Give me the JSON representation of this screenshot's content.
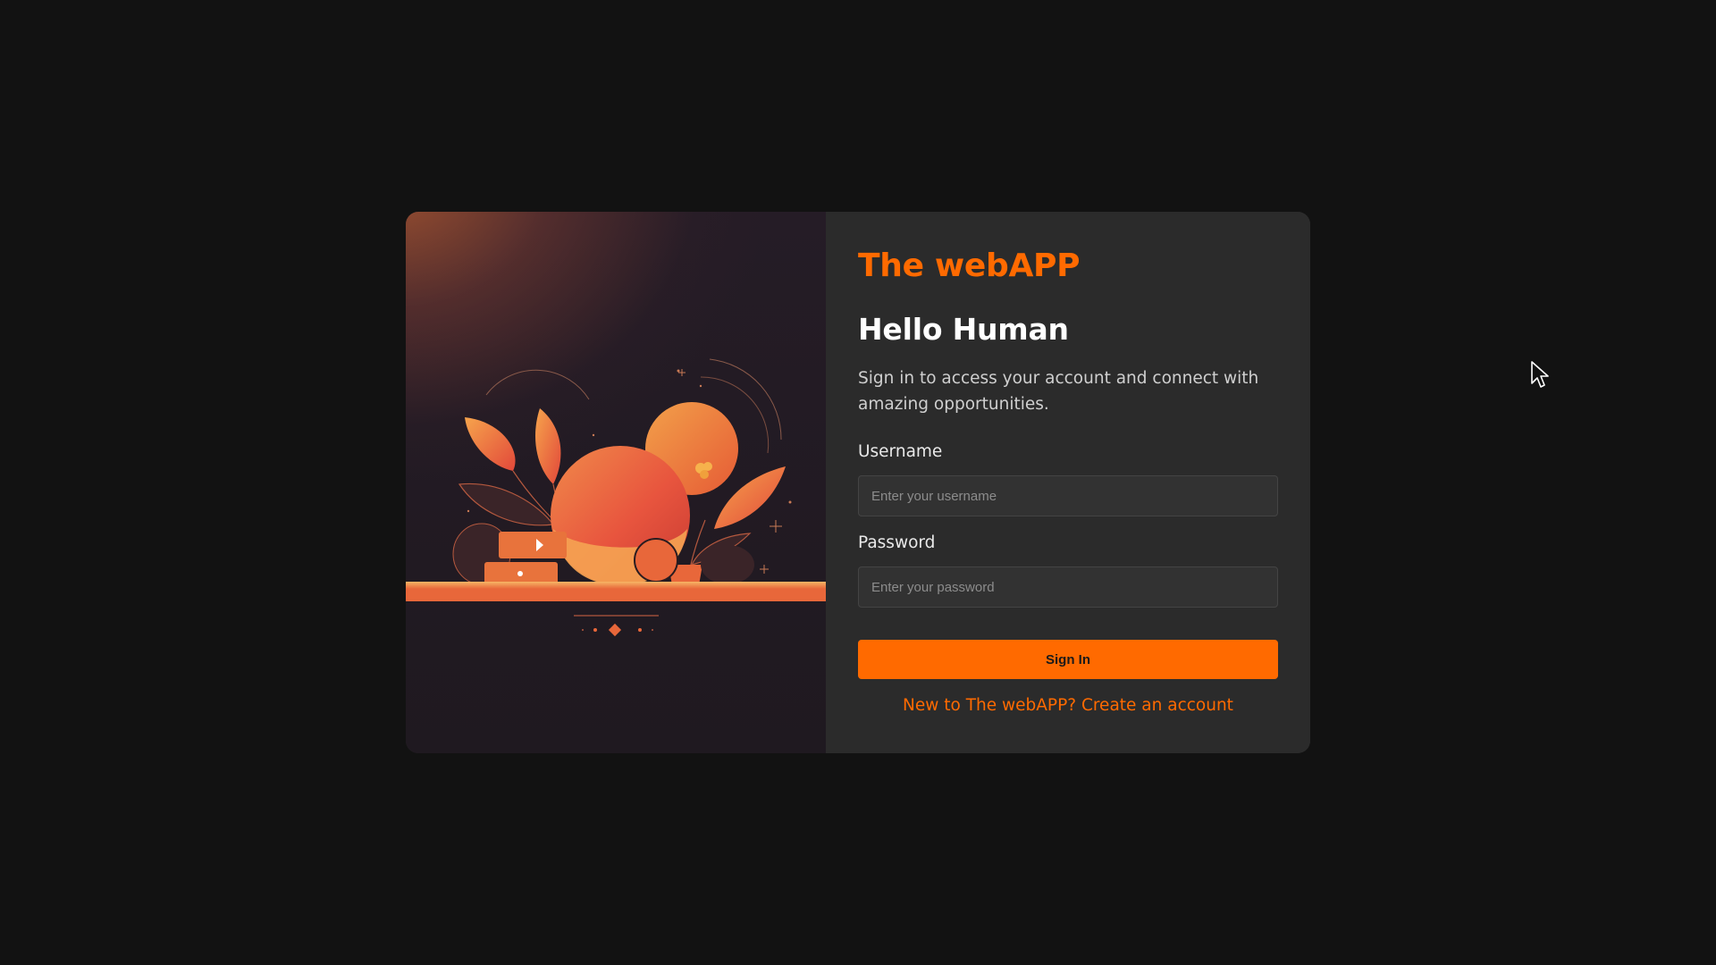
{
  "brand": {
    "name": "The webAPP",
    "accent_color": "#ff6a00"
  },
  "login": {
    "heading": "Hello Human",
    "subtitle": "Sign in to access your account and connect with amazing opportunities.",
    "username": {
      "label": "Username",
      "placeholder": "Enter your username",
      "value": ""
    },
    "password": {
      "label": "Password",
      "placeholder": "Enter your password",
      "value": ""
    },
    "submit_label": "Sign In",
    "signup_link": "New to The webAPP? Create an account"
  },
  "illustration": {
    "icon": "botanical-orange-illustration"
  },
  "colors": {
    "page_background": "#121212",
    "card_background": "#2b2b2b",
    "accent": "#ff6a00"
  }
}
